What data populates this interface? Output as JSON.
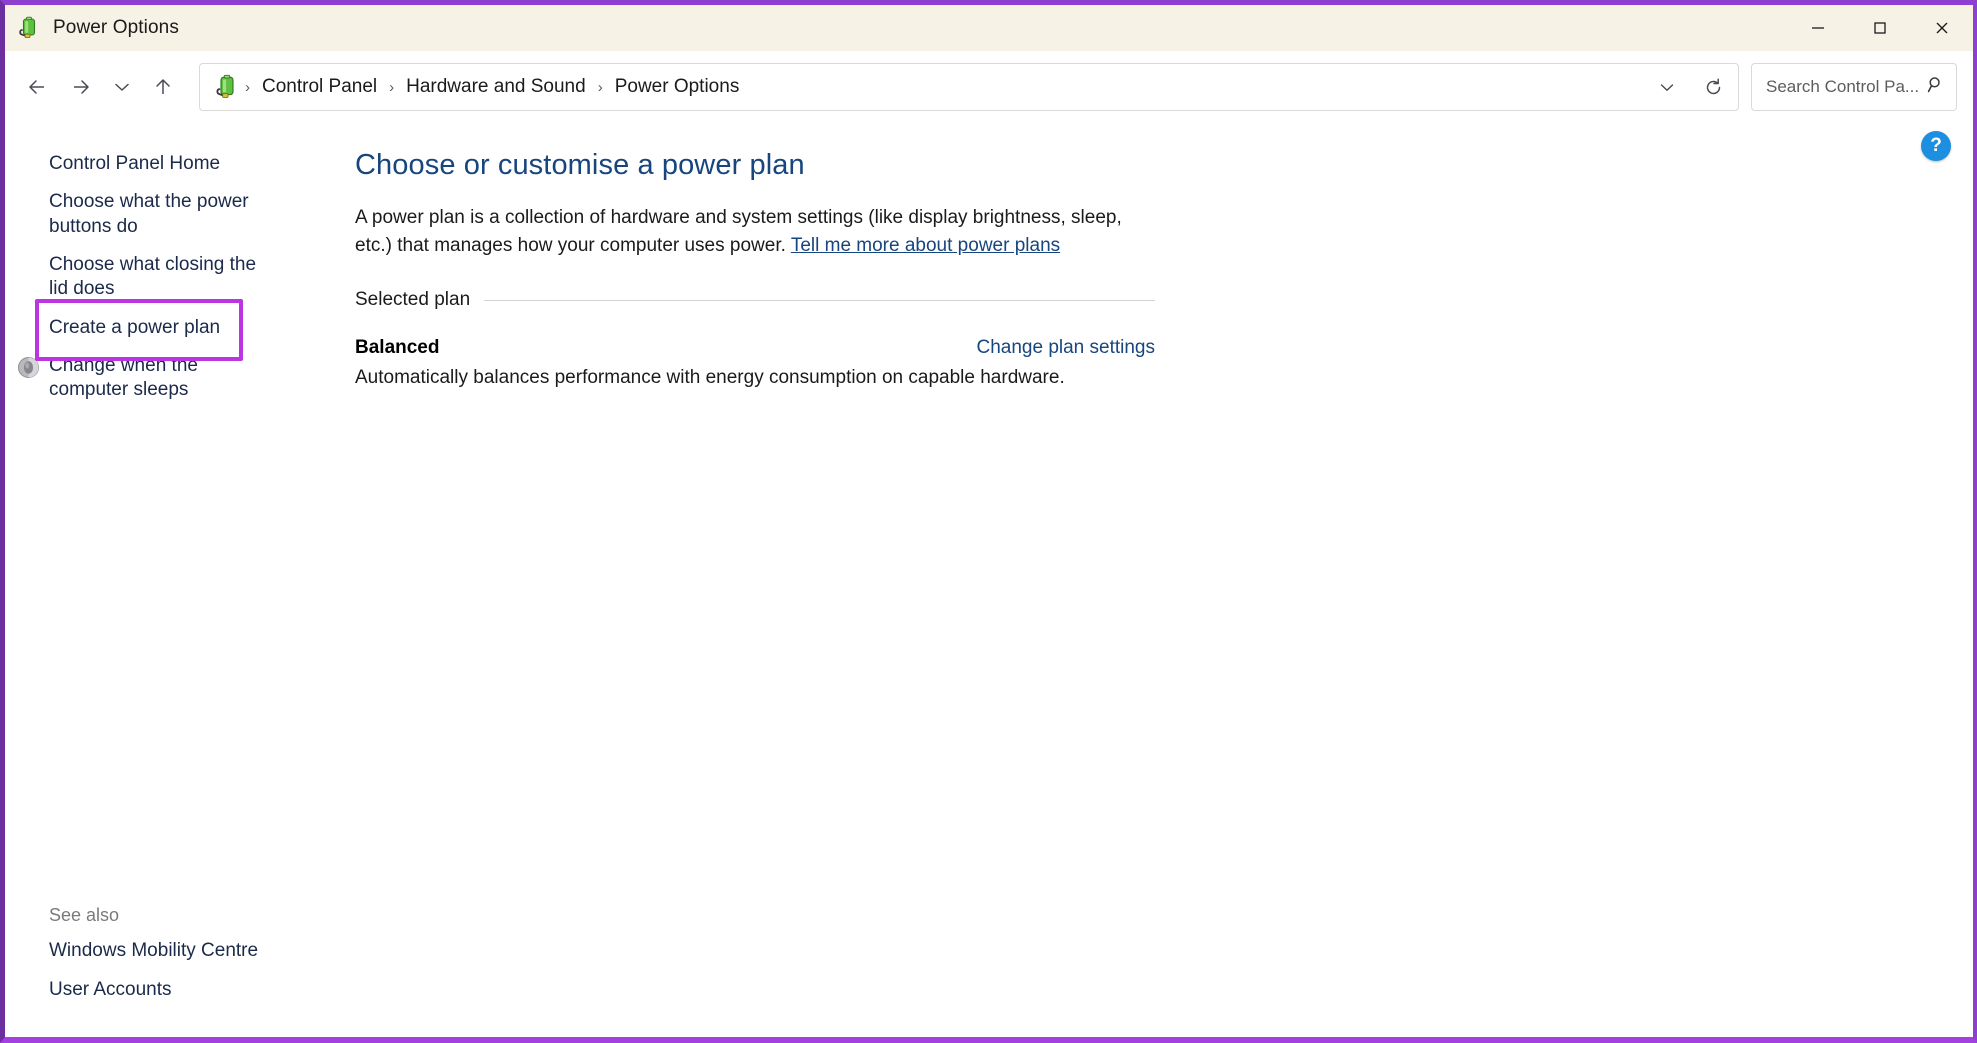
{
  "window": {
    "title": "Power Options",
    "app_icon": "power-plug-battery-icon",
    "accent_border_color": "#8e3fd0",
    "titlebar_bg": "#f7f2e6",
    "controls": {
      "minimize": "minimize-button",
      "maximize": "maximize-button",
      "close": "close-button"
    }
  },
  "nav": {
    "back": "back-arrow-icon",
    "forward": "forward-arrow-icon",
    "recent": "recent-locations-chevron-icon",
    "up": "up-arrow-icon",
    "address_icon": "power-plug-battery-icon",
    "breadcrumbs": [
      {
        "label": "Control Panel"
      },
      {
        "label": "Hardware and Sound"
      },
      {
        "label": "Power Options"
      }
    ],
    "separator": "›",
    "dropdown": "previous-locations-chevron-icon",
    "refresh": "refresh-icon"
  },
  "search": {
    "placeholder": "Search Control Pa...",
    "value": "",
    "icon": "search-icon"
  },
  "sidebar": {
    "home": "Control Panel Home",
    "items": [
      {
        "label": "Choose what the power buttons do",
        "icon": null,
        "highlighted": true
      },
      {
        "label": "Choose what closing the lid does",
        "icon": null,
        "highlighted": false
      },
      {
        "label": "Create a power plan",
        "icon": null,
        "highlighted": false
      },
      {
        "label": "Change when the computer sleeps",
        "icon": "shield-disc-icon",
        "highlighted": false
      }
    ],
    "see_also": {
      "label": "See also",
      "links": [
        {
          "label": "Windows Mobility Centre"
        },
        {
          "label": "User Accounts"
        }
      ]
    },
    "highlight_color": "#bb35e0"
  },
  "main": {
    "help_button": "?",
    "title": "Choose or customise a power plan",
    "description_part1": "A power plan is a collection of hardware and system settings (like display brightness, sleep, etc.) that manages how your computer uses power. ",
    "description_link": "Tell me more about power plans",
    "section": {
      "label": "Selected plan"
    },
    "plan": {
      "name": "Balanced",
      "change_link": "Change plan settings",
      "description": "Automatically balances performance with energy consumption on capable hardware."
    },
    "link_color": "#17457e"
  }
}
